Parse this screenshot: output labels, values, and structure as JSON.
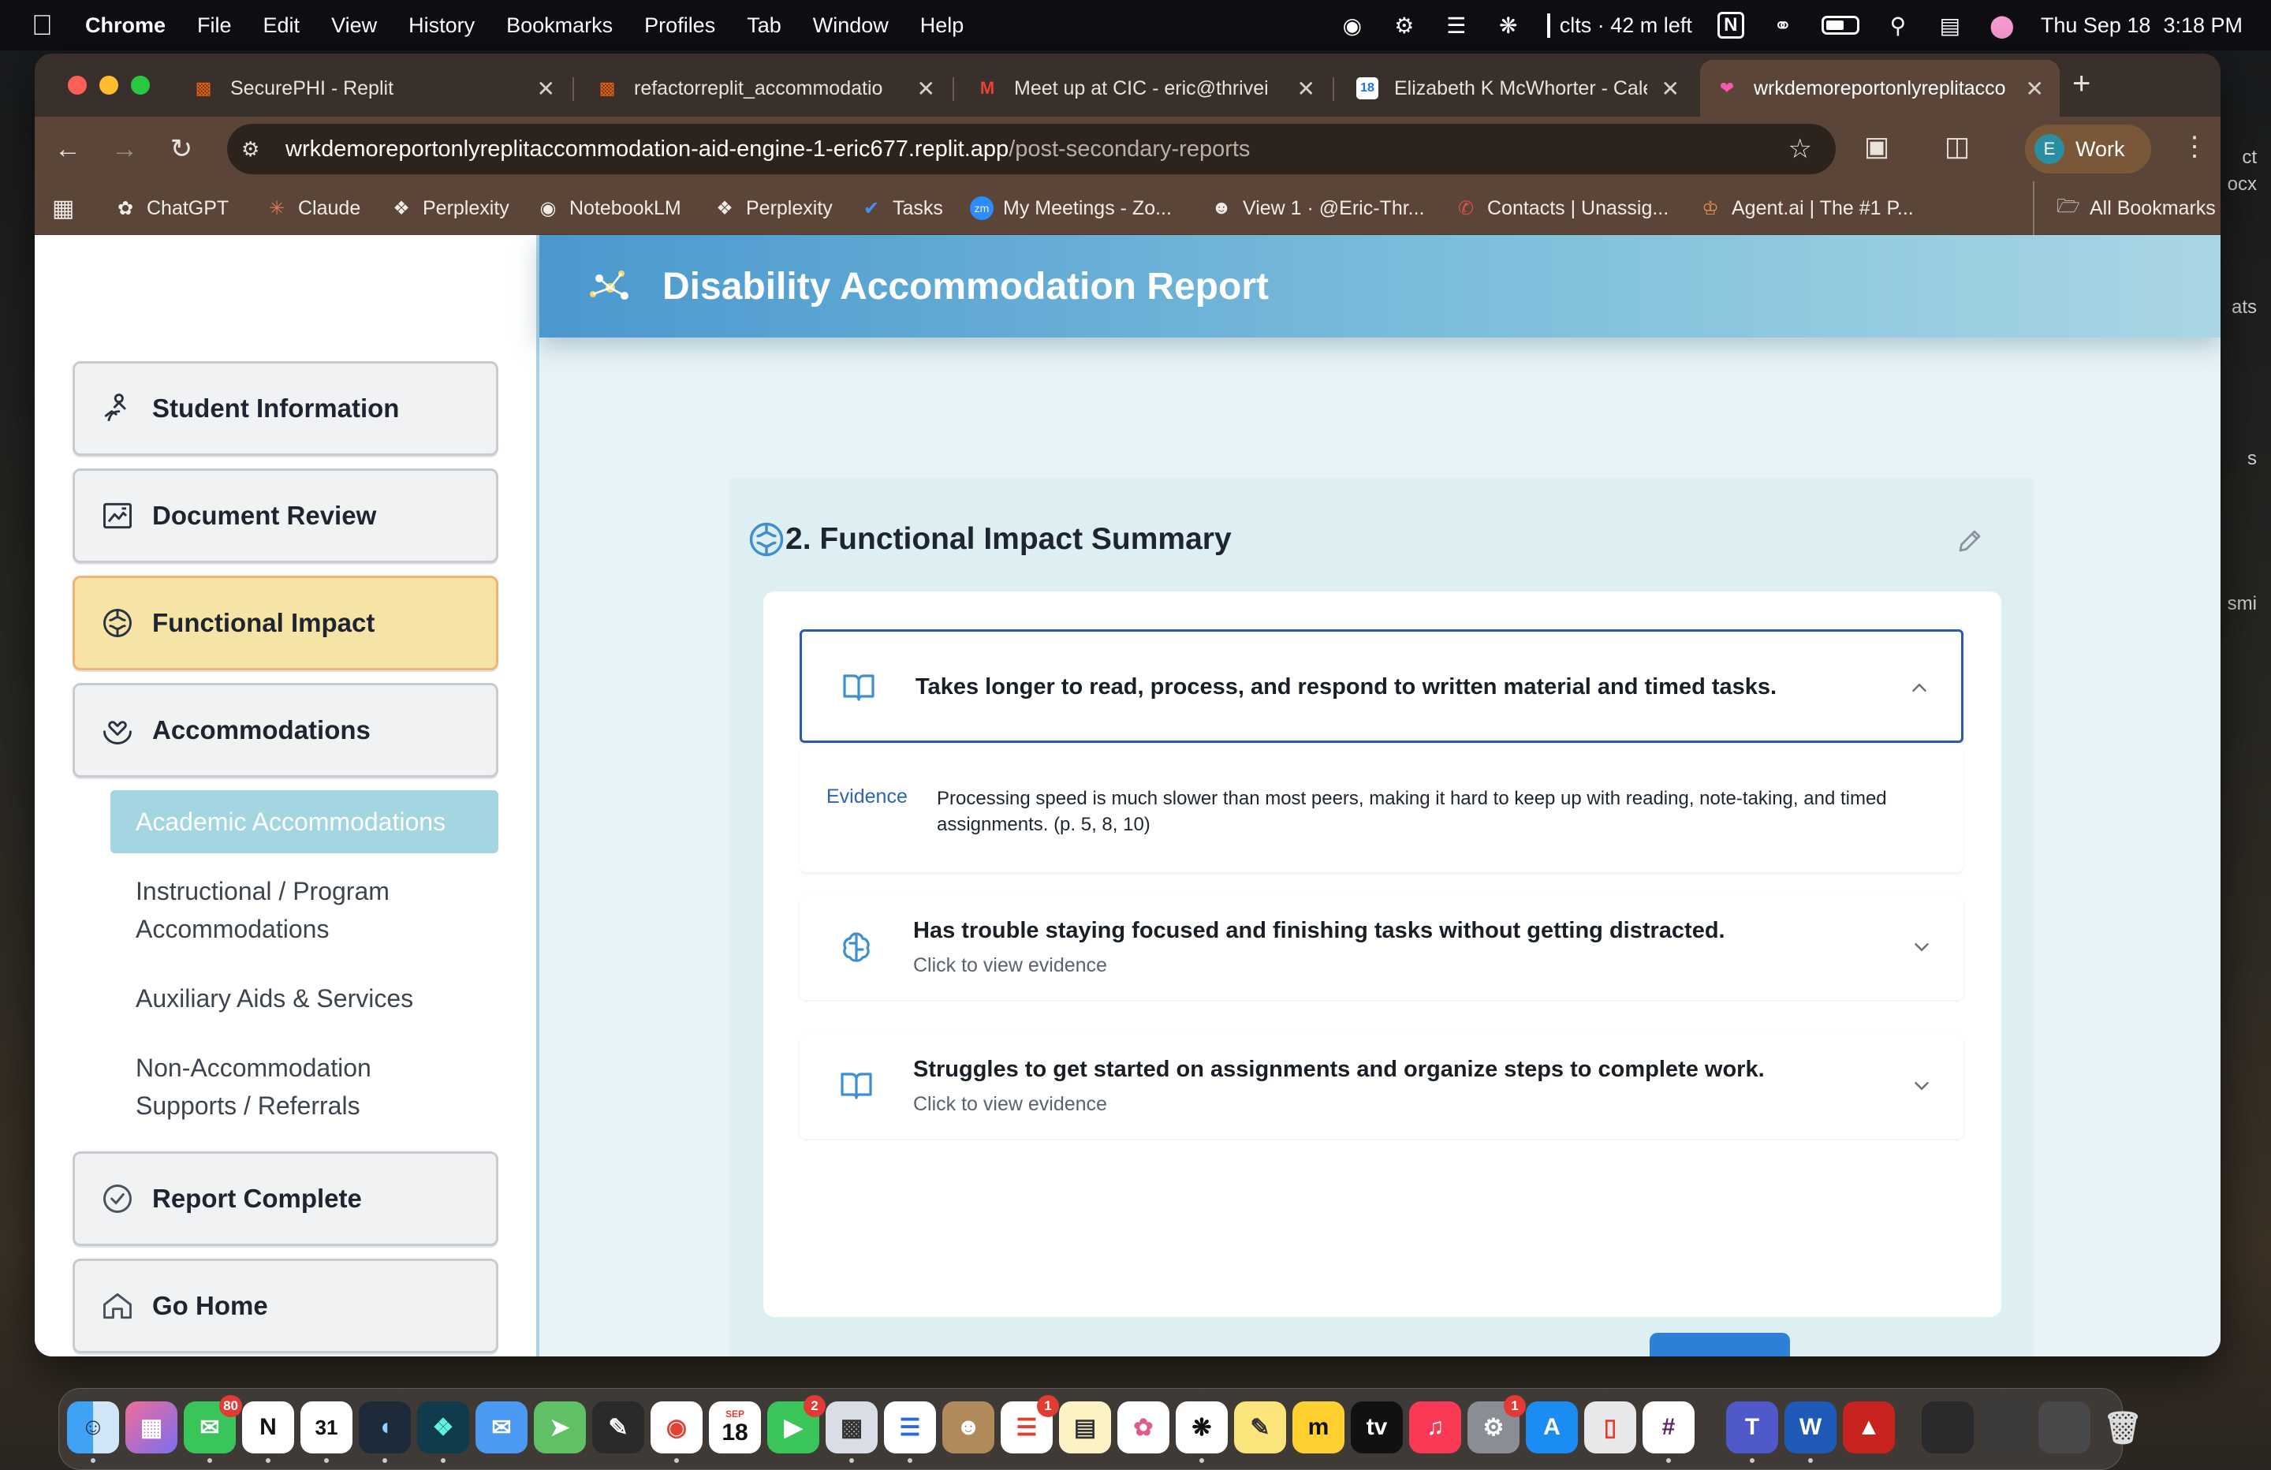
{
  "menubar": {
    "app": "Chrome",
    "items": [
      "File",
      "Edit",
      "View",
      "History",
      "Bookmarks",
      "Profiles",
      "Tab",
      "Window",
      "Help"
    ],
    "status": "clts · 42 m left",
    "date": "Thu Sep 18",
    "time": "3:18 PM",
    "edge_text": [
      "ct",
      "ocx",
      "ats",
      "s",
      "smi"
    ]
  },
  "browser": {
    "tabs": [
      {
        "title": "SecurePHI - Replit",
        "icon": "replit-icon"
      },
      {
        "title": "refactorreplit_accommodatio",
        "icon": "replit-icon"
      },
      {
        "title": "Meet up at CIC - eric@thrivei",
        "icon": "gmail-icon"
      },
      {
        "title": "Elizabeth K McWhorter - Cale",
        "icon": "calendar-icon"
      },
      {
        "title": "wrkdemoreportonlyreplitacco",
        "icon": "replit-heart-icon",
        "active": true
      }
    ],
    "url_host": "wrkdemoreportonlyreplitaccommodation-aid-engine-1-eric677.replit.app",
    "url_path": "/post-secondary-reports",
    "profile_initial": "E",
    "profile_label": "Work",
    "bookmarks": [
      "ChatGPT",
      "Claude",
      "Perplexity",
      "NotebookLM",
      "Perplexity",
      "Tasks",
      "My Meetings - Zo...",
      "View 1 · @Eric-Thr...",
      "Contacts | Unassig...",
      "Agent.ai | The #1 P..."
    ],
    "all_bookmarks": "All Bookmarks"
  },
  "app": {
    "title": "Disability Accommodation Report",
    "nav": [
      {
        "label": "Student Information",
        "icon": "student-icon"
      },
      {
        "label": "Document Review",
        "icon": "document-icon"
      },
      {
        "label": "Functional Impact",
        "icon": "brain-icon",
        "active": true
      },
      {
        "label": "Accommodations",
        "icon": "hand-heart-icon"
      }
    ],
    "subnav": {
      "active": "Academic Accommodations",
      "items": [
        [
          "Instructional / Program",
          "Accommodations"
        ],
        [
          "Auxiliary Aids & Services"
        ],
        [
          "Non-Accommodation",
          "Supports / Referrals"
        ]
      ]
    },
    "nav_bottom": [
      {
        "label": "Report Complete",
        "icon": "check-circle-icon"
      },
      {
        "label": "Go Home",
        "icon": "home-icon"
      }
    ],
    "section_title": "2. Functional Impact Summary",
    "impacts": [
      {
        "title": "Takes longer to read, process, and respond to written material and timed tasks.",
        "icon": "book-icon",
        "expanded": true,
        "evidence_label": "Evidence",
        "evidence": "Processing speed is much slower than most peers, making it hard to keep up with reading, note-taking, and timed assignments. (p. 5, 8, 10)"
      },
      {
        "title": "Has trouble staying focused and finishing tasks without getting distracted.",
        "icon": "brain-icon",
        "subtitle": "Click to view evidence"
      },
      {
        "title": "Struggles to get started on assignments and organize steps to complete work.",
        "icon": "book-icon",
        "subtitle": "Click to view evidence"
      }
    ]
  },
  "dock": {
    "badges": {
      "messages": "80",
      "facetime": "2",
      "reminders": "1",
      "settings": "1"
    },
    "calendar_month": "SEP",
    "calendar_day": "18"
  },
  "colors": {
    "header_start": "#4a98cf",
    "active_nav": "#f6e4a6",
    "active_sub": "#a4d6e2",
    "accent": "#2a5ba8"
  }
}
